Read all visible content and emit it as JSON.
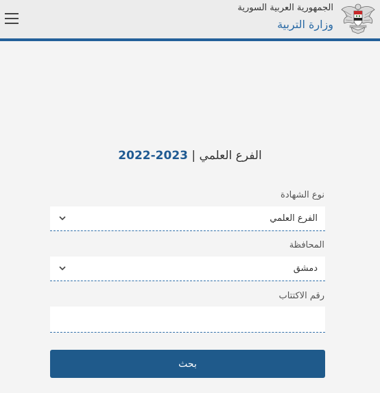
{
  "header": {
    "country": "الجمهورية العربية السورية",
    "ministry": "وزارة التربية",
    "emblem_icon": "syrian-eagle-emblem",
    "menu_icon": "hamburger-menu-icon"
  },
  "page": {
    "branch": "الفرع العلمي |",
    "year": "2023-2022"
  },
  "form": {
    "certificate_type": {
      "label": "نوع الشهادة",
      "value": "الفرع العلمي"
    },
    "governorate": {
      "label": "المحافظة",
      "value": "دمشق"
    },
    "exam_number": {
      "label": "رقم الاكتتاب",
      "value": ""
    },
    "submit_label": "بحث"
  },
  "colors": {
    "accent": "#23609a",
    "button": "#1f5a8b",
    "background": "#f4f4f4",
    "header": "#ececec"
  }
}
